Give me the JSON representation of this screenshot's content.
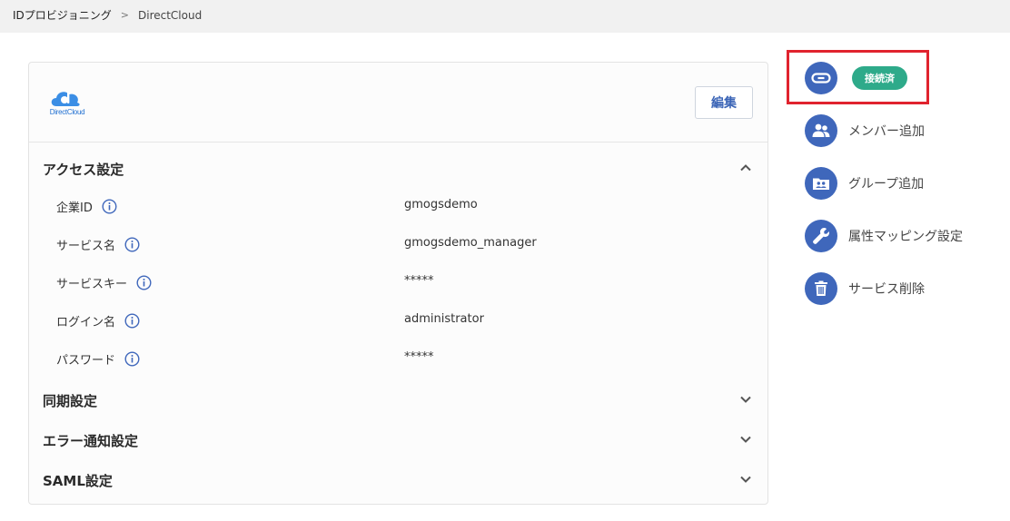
{
  "breadcrumb": {
    "parent": "IDプロビジョニング",
    "separator": ">",
    "current": "DirectCloud"
  },
  "card": {
    "logo_text": "DirectCloud",
    "edit_label": "編集",
    "sections": {
      "access": {
        "title": "アクセス設定",
        "expanded": true,
        "fields": [
          {
            "label": "企業ID",
            "value": "gmogsdemo"
          },
          {
            "label": "サービス名",
            "value": "gmogsdemo_manager"
          },
          {
            "label": "サービスキー",
            "value": "*****"
          },
          {
            "label": "ログイン名",
            "value": "administrator"
          },
          {
            "label": "パスワード",
            "value": "*****"
          }
        ]
      },
      "sync": {
        "title": "同期設定",
        "expanded": false
      },
      "error": {
        "title": "エラー通知設定",
        "expanded": false
      },
      "saml": {
        "title": "SAML設定",
        "expanded": false
      }
    }
  },
  "sidebar": {
    "connection": {
      "icon": "link-icon",
      "status": "接続済"
    },
    "items": [
      {
        "icon": "users-icon",
        "label": "メンバー追加"
      },
      {
        "icon": "group-folder-icon",
        "label": "グループ追加"
      },
      {
        "icon": "wrench-icon",
        "label": "属性マッピング設定"
      },
      {
        "icon": "trash-icon",
        "label": "サービス削除"
      }
    ]
  },
  "colors": {
    "accent": "#3f67bb",
    "status_connected": "#2eaa8a",
    "highlight": "#e0232e"
  }
}
